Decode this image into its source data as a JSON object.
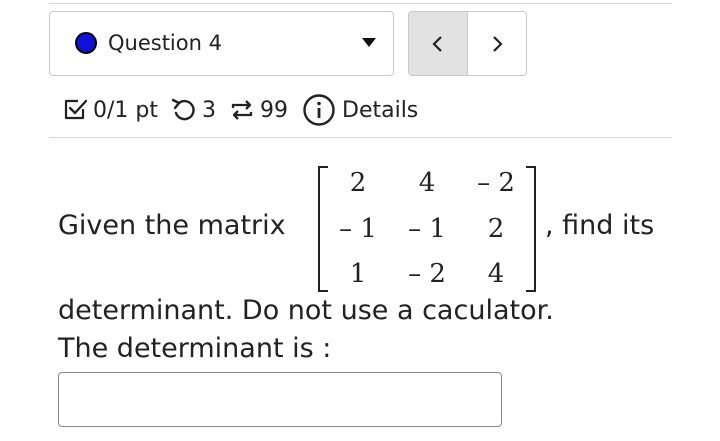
{
  "question_selector": {
    "label": "Question 4",
    "status_color": "#1010d8"
  },
  "nav": {
    "prev_icon": "chevron-left-icon",
    "next_icon": "chevron-right-icon"
  },
  "meta": {
    "score": "0/1 pt",
    "retries": "3",
    "attempts": "99",
    "details_label": "Details"
  },
  "question": {
    "text_before_matrix": "Given the matrix",
    "text_after_matrix": ", find its",
    "text_line2": "determinant. Do not use a caculator.",
    "prompt": "The determinant is :",
    "matrix": [
      [
        "2",
        "4",
        "– 2"
      ],
      [
        "– 1",
        "– 1",
        "2"
      ],
      [
        "1",
        "– 2",
        "4"
      ]
    ]
  },
  "answer": {
    "value": ""
  }
}
